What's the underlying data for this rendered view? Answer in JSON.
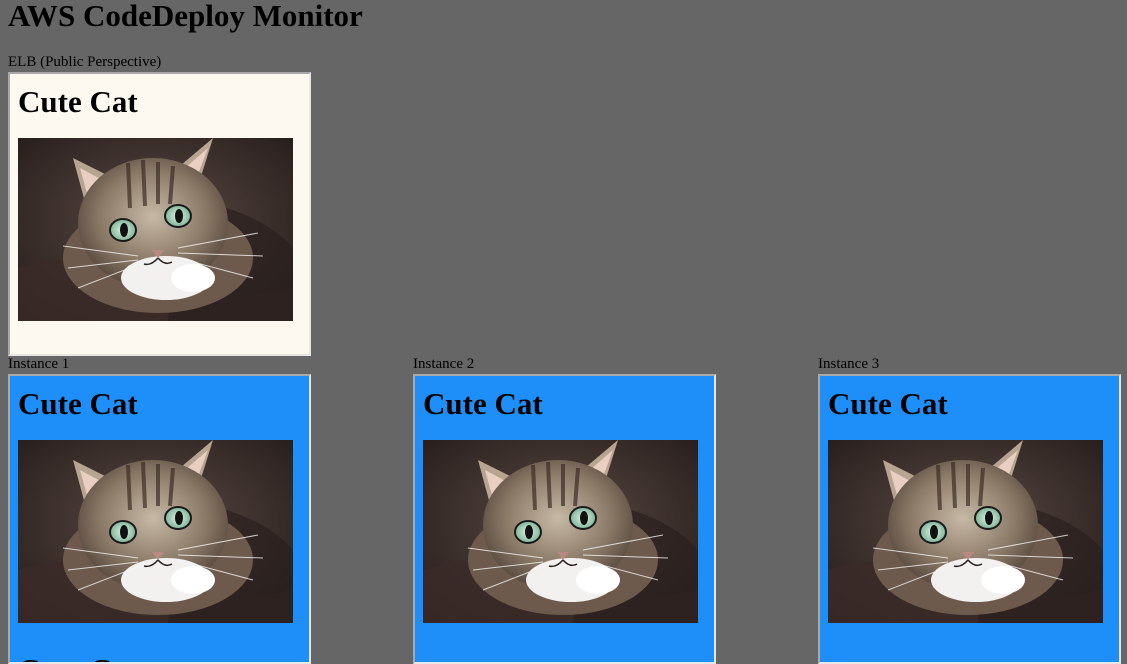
{
  "page": {
    "title": "AWS CodeDeploy Monitor"
  },
  "elb": {
    "label": "ELB (Public Perspective)",
    "heading": "Cute Cat",
    "image_alt": "cat-photo"
  },
  "instances": [
    {
      "label": "Instance 1",
      "heading": "Cute Cat",
      "next_heading": "Cute Cat"
    },
    {
      "label": "Instance 2",
      "heading": "Cute Cat"
    },
    {
      "label": "Instance 3",
      "heading": "Cute Cat"
    }
  ],
  "colors": {
    "page_background": "#666666",
    "elb_frame_background": "#fef9f0",
    "instance_frame_background": "#1e8ef8"
  }
}
